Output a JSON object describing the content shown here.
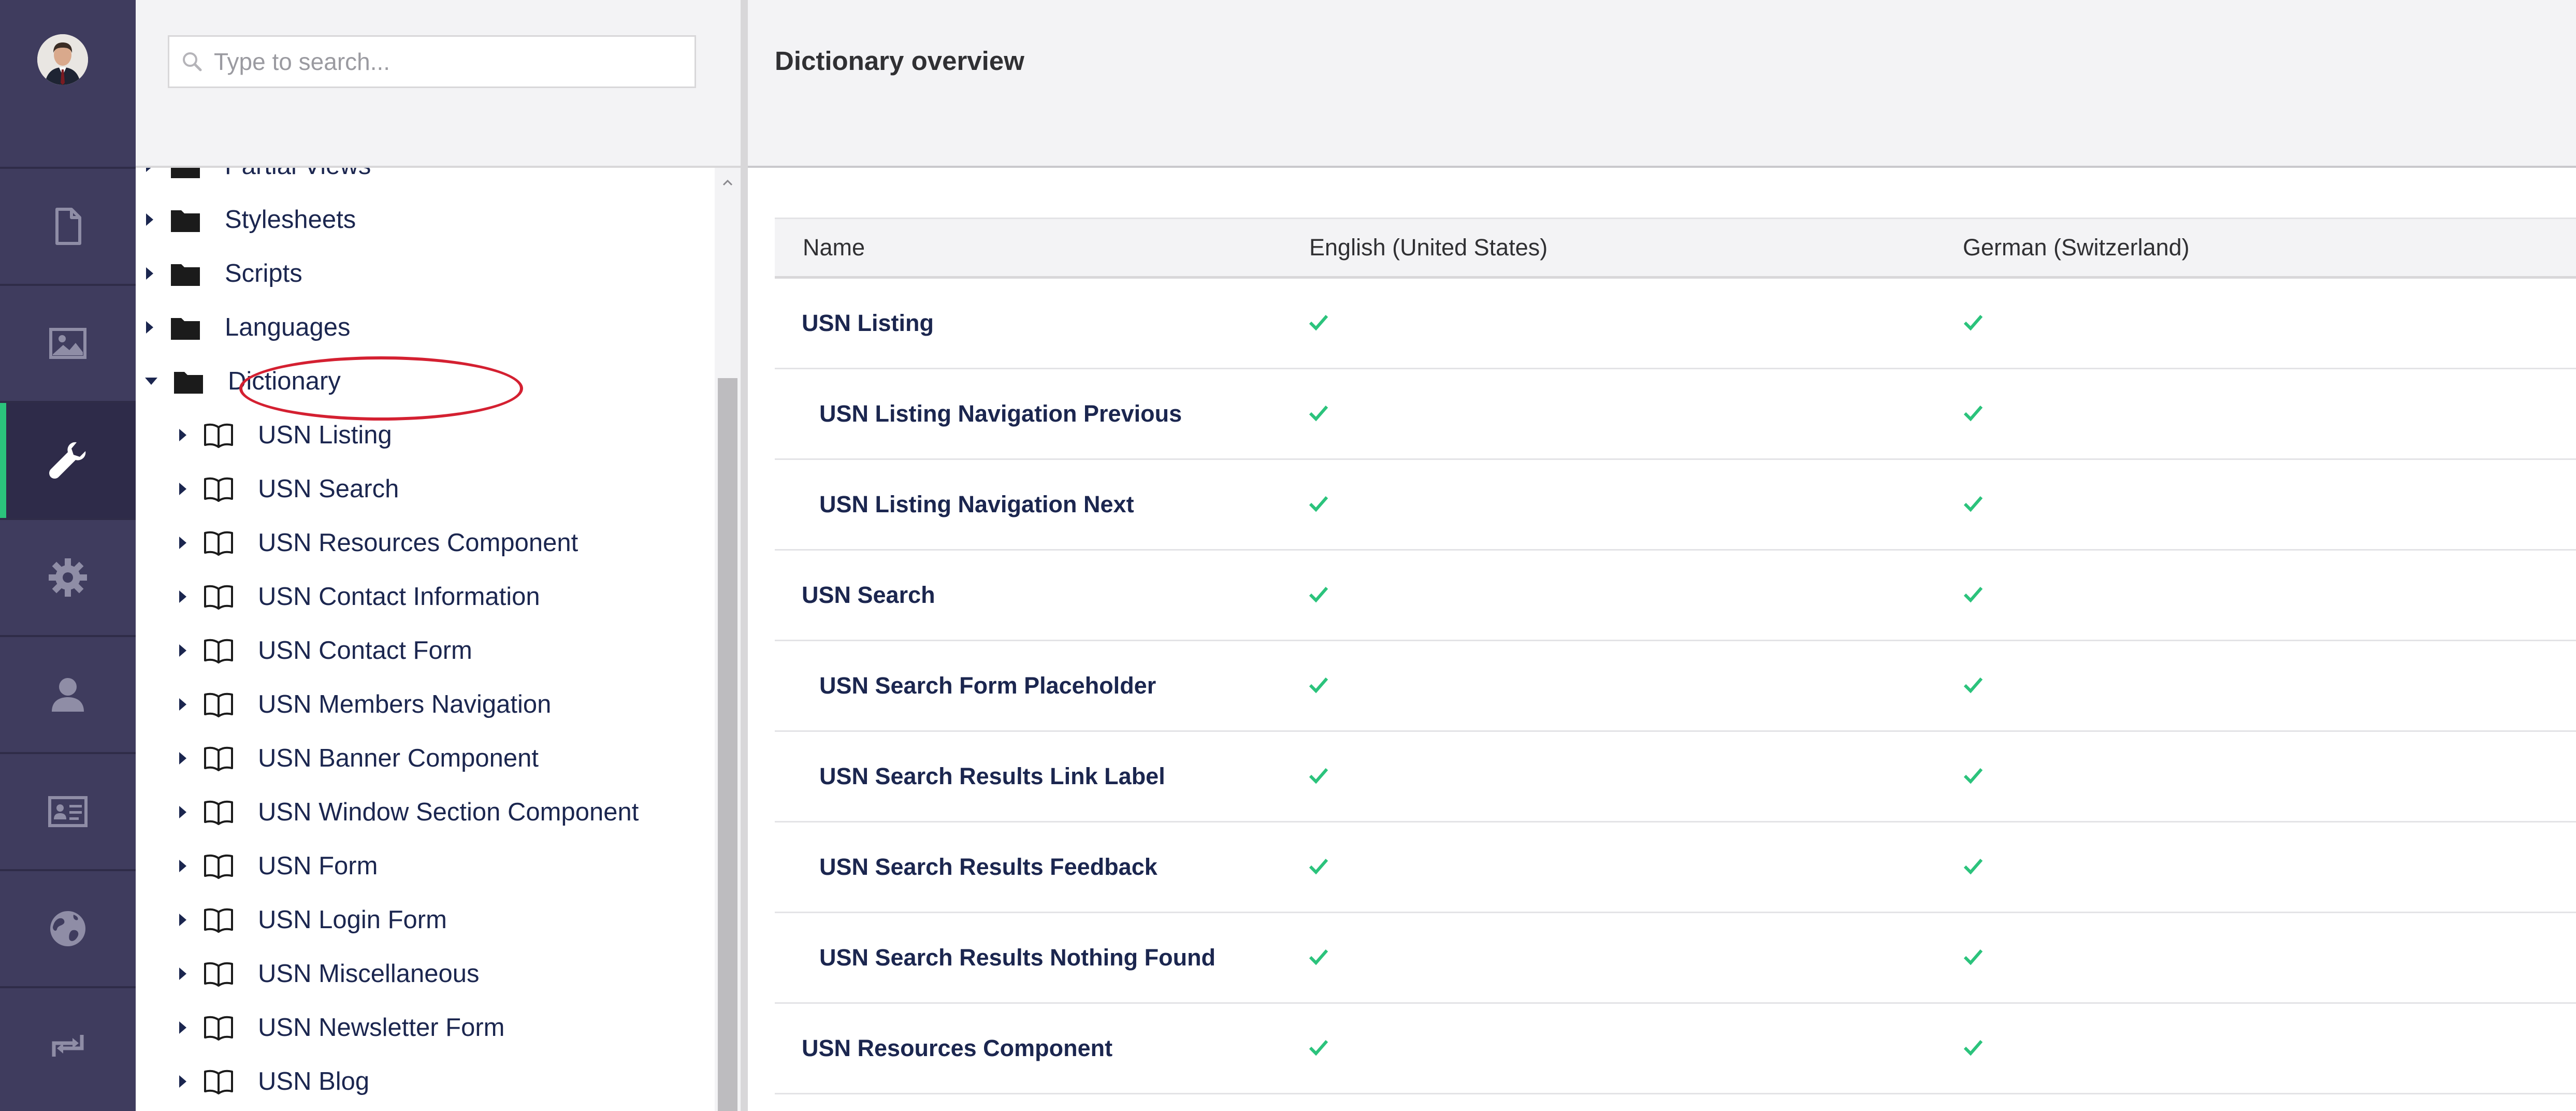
{
  "colors": {
    "rail_bg": "#3f3c5e",
    "rail_active_indicator": "#2bc37c",
    "check_green": "#2bc37c",
    "annotation_red": "#d42031",
    "text_dark": "#1b264f"
  },
  "rail": {
    "items": [
      {
        "icon": "document-icon",
        "active": false
      },
      {
        "icon": "image-icon",
        "active": false
      },
      {
        "icon": "wrench-icon",
        "active": true
      },
      {
        "icon": "gear-icon",
        "active": false
      },
      {
        "icon": "user-icon",
        "active": false
      },
      {
        "icon": "contact-card-icon",
        "active": false
      },
      {
        "icon": "globe-icon",
        "active": false
      },
      {
        "icon": "transfer-icon",
        "active": false
      }
    ]
  },
  "search": {
    "placeholder": "Type to search..."
  },
  "tree": {
    "folders": [
      "Partial Views",
      "Stylesheets",
      "Scripts",
      "Languages",
      "Dictionary"
    ],
    "expanded_folder": "Dictionary",
    "dictionary_items": [
      "USN Listing",
      "USN Search",
      "USN Resources Component",
      "USN Contact Information",
      "USN Contact Form",
      "USN Members Navigation",
      "USN Banner Component",
      "USN Window Section Component",
      "USN Form",
      "USN Login Form",
      "USN Miscellaneous",
      "USN Newsletter Form",
      "USN Blog"
    ]
  },
  "main": {
    "title": "Dictionary overview",
    "columns": [
      "Name",
      "English (United States)",
      "German (Switzerland)"
    ],
    "rows": [
      {
        "name": "USN Listing",
        "indent": 0,
        "en": true,
        "de": true
      },
      {
        "name": "USN Listing Navigation Previous",
        "indent": 1,
        "en": true,
        "de": true
      },
      {
        "name": "USN Listing Navigation Next",
        "indent": 1,
        "en": true,
        "de": true
      },
      {
        "name": "USN Search",
        "indent": 0,
        "en": true,
        "de": true
      },
      {
        "name": "USN Search Form Placeholder",
        "indent": 1,
        "en": true,
        "de": true
      },
      {
        "name": "USN Search Results Link Label",
        "indent": 1,
        "en": true,
        "de": true
      },
      {
        "name": "USN Search Results Feedback",
        "indent": 1,
        "en": true,
        "de": true
      },
      {
        "name": "USN Search Results Nothing Found",
        "indent": 1,
        "en": true,
        "de": true
      },
      {
        "name": "USN Resources Component",
        "indent": 0,
        "en": true,
        "de": true
      }
    ]
  }
}
